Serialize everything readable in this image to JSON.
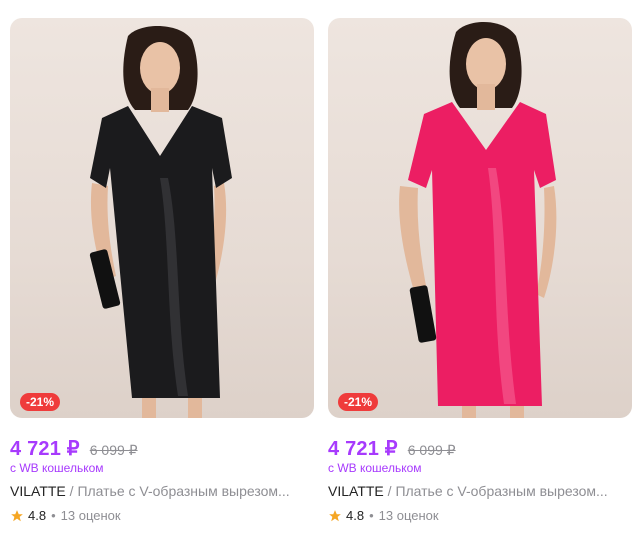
{
  "products": [
    {
      "discount": "-21%",
      "price": "4 721 ₽",
      "old_price": "6 099 ₽",
      "wallet_note": "с WB кошельком",
      "brand": "VILATTE",
      "separator": "/",
      "name": "Платье с V-образным вырезом...",
      "rating": "4.8",
      "reviews": "13 оценок",
      "dress_color": "#1b1b1d",
      "dress_highlight": "#3a3a3e"
    },
    {
      "discount": "-21%",
      "price": "4 721 ₽",
      "old_price": "6 099 ₽",
      "wallet_note": "с WB кошельком",
      "brand": "VILATTE",
      "separator": "/",
      "name": "Платье с V-образным вырезом...",
      "rating": "4.8",
      "reviews": "13 оценок",
      "dress_color": "#ec1e63",
      "dress_highlight": "#f5588d"
    }
  ],
  "colors": {
    "price": "#a73afd",
    "badge": "#ef3b3b",
    "star": "#f5a623"
  }
}
